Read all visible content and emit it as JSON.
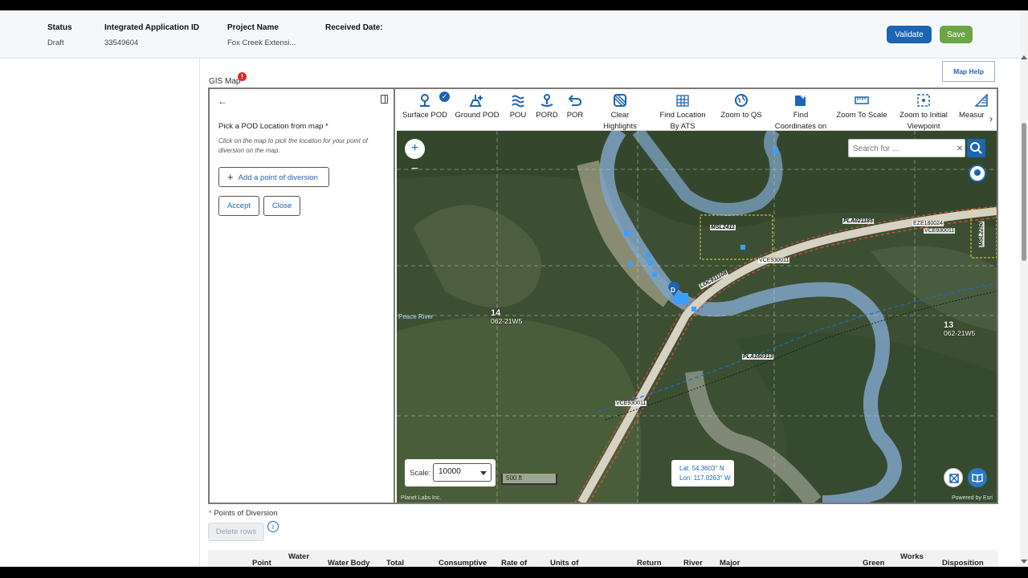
{
  "header": {
    "status_label": "Status",
    "status_value": "Draft",
    "app_id_label": "Integrated Application ID",
    "app_id_value": "33549604",
    "project_label": "Project Name",
    "project_value": "Fox Creek Extensi...",
    "received_label": "Received Date:",
    "validate_label": "Validate",
    "save_label": "Save"
  },
  "gis": {
    "label": "GIS Map",
    "badge": "!",
    "map_help": "Map Help"
  },
  "panel": {
    "title": "Pick a POD Location from map  *",
    "description": "Click on the map to pick the location for your point of diversion on the map.",
    "add_label": "Add a point of diversion",
    "accept_label": "Accept",
    "close_label": "Close"
  },
  "toolbar": {
    "tools": [
      {
        "label": "Surface POD",
        "icon": "surface-pod-icon"
      },
      {
        "label": "Ground POD",
        "icon": "ground-pod-icon"
      },
      {
        "label": "POU",
        "icon": "pou-icon"
      },
      {
        "label": "PORD",
        "icon": "pord-icon"
      },
      {
        "label": "POR",
        "icon": "por-icon"
      },
      {
        "label": "Clear Highlights",
        "icon": "clear-highlights-icon"
      },
      {
        "label": "Find Location By ATS",
        "icon": "find-ats-icon"
      },
      {
        "label": "Zoom to QS",
        "icon": "zoom-qs-icon"
      },
      {
        "label": "Find Coordinates on",
        "icon": "find-coordinates-icon"
      },
      {
        "label": "Zoom To Scale",
        "icon": "zoom-scale-icon"
      },
      {
        "label": "Zoom to Initial Viewpoint",
        "icon": "initial-viewpoint-icon"
      },
      {
        "label": "Measur",
        "icon": "measure-icon"
      }
    ]
  },
  "map": {
    "search_placeholder": "Search for ...",
    "scale_label": "Scale:",
    "scale_value": "10000",
    "scalebar": "500 ft",
    "lat": "Lat: 54.3603° N",
    "lon": "Lon: 117.0263° W",
    "attribution_left": "Planet Labs Inc.",
    "attribution_right": "Powered by Esri",
    "pin_label": "D",
    "labels": {
      "peace_river": "Peace River",
      "msl2411": "MSL2411",
      "pla021185": "PLA021185",
      "eze180024": "EZE180024",
      "vce930011_a": "VCE930011",
      "vce930011_b": "VCE930011",
      "vce930011_c": "VCE930011",
      "loc911108": "LOC911108",
      "pla160313": "PLA160313",
      "msl2250": "MSL2250"
    },
    "twp14": {
      "num": "14",
      "code": "062-21W5"
    },
    "twp13": {
      "num": "13",
      "code": "062-21W5"
    }
  },
  "pods": {
    "label": "Points of Diversion",
    "delete_label": "Delete rows",
    "columns": [
      "Point",
      "Water",
      "Water Body",
      "Total",
      "Consumptive",
      "Rate of",
      "Units of",
      "Return",
      "River",
      "Major",
      "Green",
      "Works",
      "Disposition"
    ]
  },
  "colors": {
    "primary": "#1c64b4",
    "success": "#6ca544",
    "error": "#d92b2b",
    "header_bg": "#f4f8fb"
  }
}
